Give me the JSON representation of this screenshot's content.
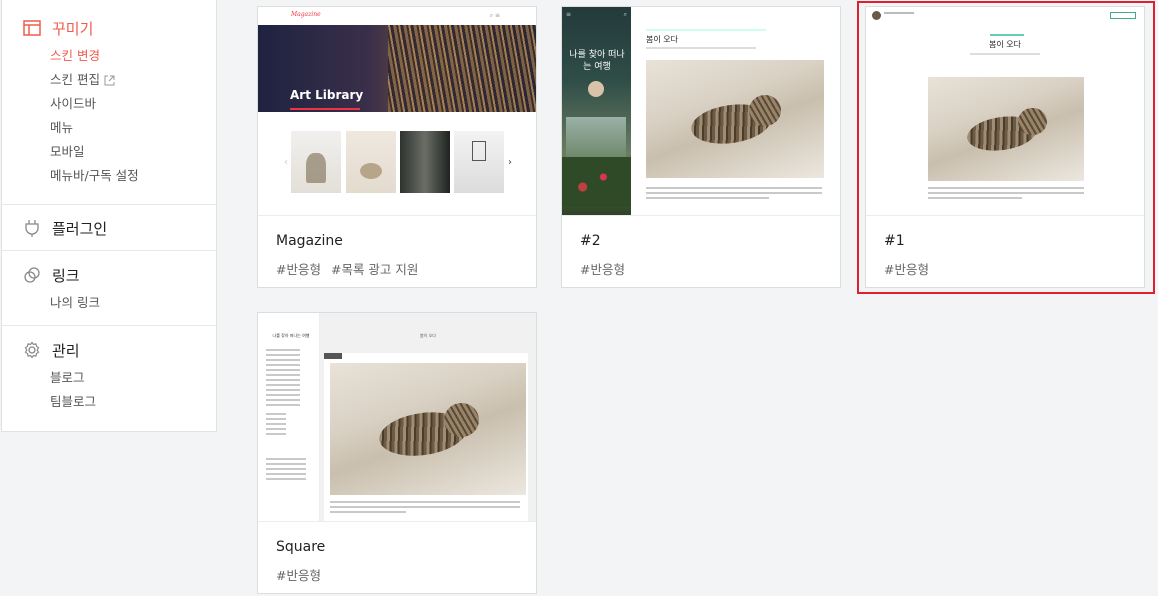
{
  "sidebar": {
    "decorate": {
      "title": "꾸미기",
      "items": [
        "스킨 변경",
        "스킨 편집",
        "사이드바",
        "메뉴",
        "모바일",
        "메뉴바/구독 설정"
      ]
    },
    "plugin": {
      "title": "플러그인"
    },
    "link": {
      "title": "링크",
      "items": [
        "나의 링크"
      ]
    },
    "manage": {
      "title": "관리",
      "items": [
        "블로그",
        "팀블로그"
      ]
    }
  },
  "skins": [
    {
      "name": "Magazine",
      "tags": [
        "#반응형",
        "#목록 광고 지원"
      ],
      "preview": {
        "logo": "Magazine",
        "banner": "Art Library"
      }
    },
    {
      "name": "#2",
      "tags": [
        "#반응형"
      ],
      "preview": {
        "side_text": "나를 찾아 떠나는 여행",
        "post_title": "봄이 오다"
      }
    },
    {
      "name": "#1",
      "tags": [
        "#반응형"
      ],
      "preview": {
        "post_title": "봄이 오다"
      }
    },
    {
      "name": "Square",
      "tags": [
        "#반응형"
      ],
      "preview": {
        "side_title": "나를 찾아 떠나는 여행",
        "post_title": "봄이 오다"
      }
    }
  ],
  "colors": {
    "accent": "#f15c4f",
    "selection": "#e0202f"
  }
}
